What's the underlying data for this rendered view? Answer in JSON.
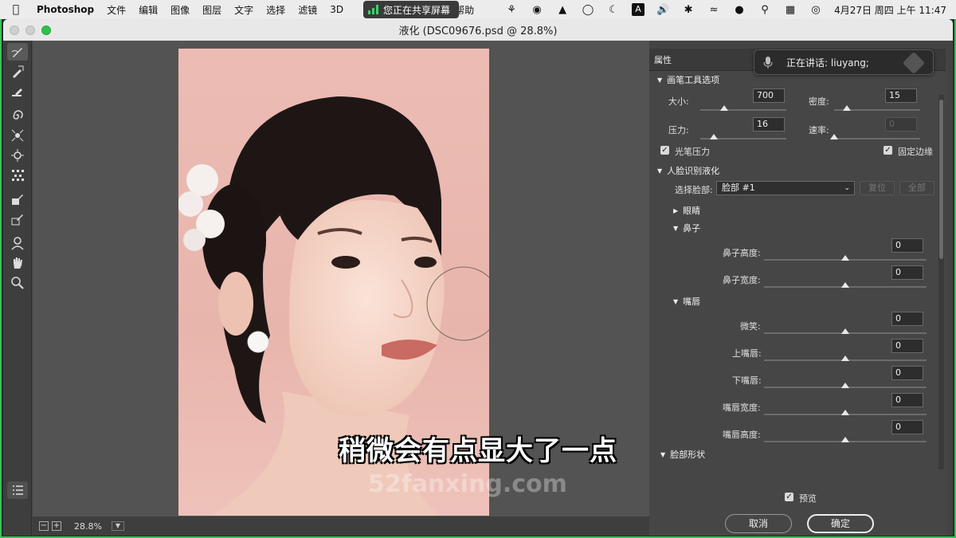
{
  "menubar": {
    "app": "Photoshop",
    "items": [
      "文件",
      "编辑",
      "图像",
      "图层",
      "文字",
      "选择",
      "滤镜",
      "3D"
    ],
    "help": "帮助",
    "sharing_label": "您正在共享屏幕",
    "clock": "4月27日 周四 上午 11:47"
  },
  "window": {
    "title": "液化 (DSC09676.psd @ 28.8%)"
  },
  "status": {
    "zoom": "28.8%"
  },
  "subtitle": "稍微会有点显大了一点",
  "watermark": "52fanxing.com",
  "speaking": {
    "label": "正在讲话: liuyang;"
  },
  "panel": {
    "title": "属性",
    "brush_section": "画笔工具选项",
    "size_label": "大小:",
    "size_value": "700",
    "size_level": 0.28,
    "density_label": "密度:",
    "density_value": "15",
    "density_level": 0.15,
    "pressure_label": "压力:",
    "pressure_value": "16",
    "pressure_level": 0.16,
    "rate_label": "速率:",
    "rate_value": "0",
    "rate_level": 0.0,
    "stylus_label": "光笔压力",
    "pin_edges_label": "固定边缘",
    "face_section": "人脸识别液化",
    "select_face_label": "选择脸部:",
    "select_face_value": "脸部 #1",
    "reset_label": "复位",
    "all_label": "全部",
    "eyes_label": "眼睛",
    "nose_label": "鼻子",
    "nose_height_label": "鼻子高度:",
    "nose_height_value": "0",
    "nose_width_label": "鼻子宽度:",
    "nose_width_value": "0",
    "mouth_label": "嘴唇",
    "smile_label": "微笑:",
    "smile_value": "0",
    "upper_lip_label": "上嘴唇:",
    "upper_lip_value": "0",
    "lower_lip_label": "下嘴唇:",
    "lower_lip_value": "0",
    "mouth_width_label": "嘴唇宽度:",
    "mouth_width_value": "0",
    "mouth_height_label": "嘴唇高度:",
    "mouth_height_value": "0",
    "face_shape_label": "脸部形状",
    "preview_label": "预览",
    "cancel_label": "取消",
    "ok_label": "确定"
  },
  "colors": {
    "accent_green": "#37c25a",
    "panel_bg": "#464646",
    "canvas_bg": "#535353"
  }
}
